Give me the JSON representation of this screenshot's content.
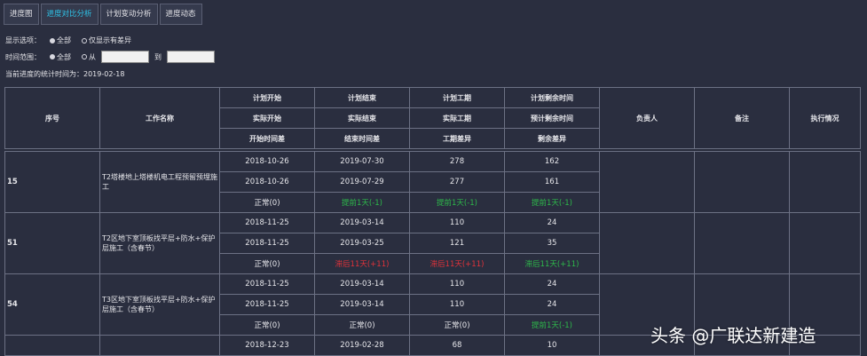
{
  "tabs": [
    {
      "label": "进度图",
      "active": false
    },
    {
      "label": "进度对比分析",
      "active": true
    },
    {
      "label": "计划变动分析",
      "active": false
    },
    {
      "label": "进度动态",
      "active": false
    }
  ],
  "display_options": {
    "label": "显示选项：",
    "all": "全部",
    "only_diff": "仅显示有差异"
  },
  "time_range": {
    "label": "时间范围：",
    "all": "全部",
    "from": "从",
    "to": "到"
  },
  "stat_time": "当前进度的统计时间为：2019-02-18",
  "headers": {
    "seq": "序号",
    "name": "工作名称",
    "plan_start": "计划开始",
    "actual_start": "实际开始",
    "start_diff": "开始时间差",
    "plan_end": "计划结束",
    "actual_end": "实际结束",
    "end_diff": "结束时间差",
    "plan_days": "计划工期",
    "actual_days": "实际工期",
    "days_diff": "工期差异",
    "plan_remaining": "计划剩余时间",
    "est_remaining": "预计剩余时间",
    "remaining_diff": "剩余差异",
    "owner": "负责人",
    "remark": "备注",
    "status": "执行情况"
  },
  "rows": [
    {
      "seq": "15",
      "name": "T2塔楼地上塔楼机电工程预留预埋施工",
      "r1": [
        "2018-10-26",
        "2019-07-30",
        "278",
        "162"
      ],
      "r2": [
        "2018-10-26",
        "2019-07-29",
        "277",
        "161"
      ],
      "r3": [
        "正常(0)",
        "提前1天(-1)",
        "提前1天(-1)",
        "提前1天(-1)"
      ]
    },
    {
      "seq": "51",
      "name": "T2区地下室顶板找平层+防水+保护层施工（含春节）",
      "r1": [
        "2018-11-25",
        "2019-03-14",
        "110",
        "24"
      ],
      "r2": [
        "2018-11-25",
        "2019-03-25",
        "121",
        "35"
      ],
      "r3": [
        "正常(0)",
        "滞后11天(+11)",
        "滞后11天(+11)",
        "滞后11天(+11)"
      ]
    },
    {
      "seq": "54",
      "name": "T3区地下室顶板找平层+防水+保护层施工（含春节）",
      "r1": [
        "2018-11-25",
        "2019-03-14",
        "110",
        "24"
      ],
      "r2": [
        "2018-11-25",
        "2019-03-14",
        "110",
        "24"
      ],
      "r3": [
        "正常(0)",
        "正常(0)",
        "正常(0)",
        "提前1天(-1)"
      ]
    },
    {
      "seq": "",
      "name": "",
      "r1": [
        "2018-12-23",
        "2019-02-28",
        "68",
        "10"
      ]
    }
  ],
  "colors": {
    "normal": "#e6e6ea",
    "ahead": "#2db84a",
    "behind": "#e0323a"
  },
  "watermark": "头条 @广联达新建造"
}
